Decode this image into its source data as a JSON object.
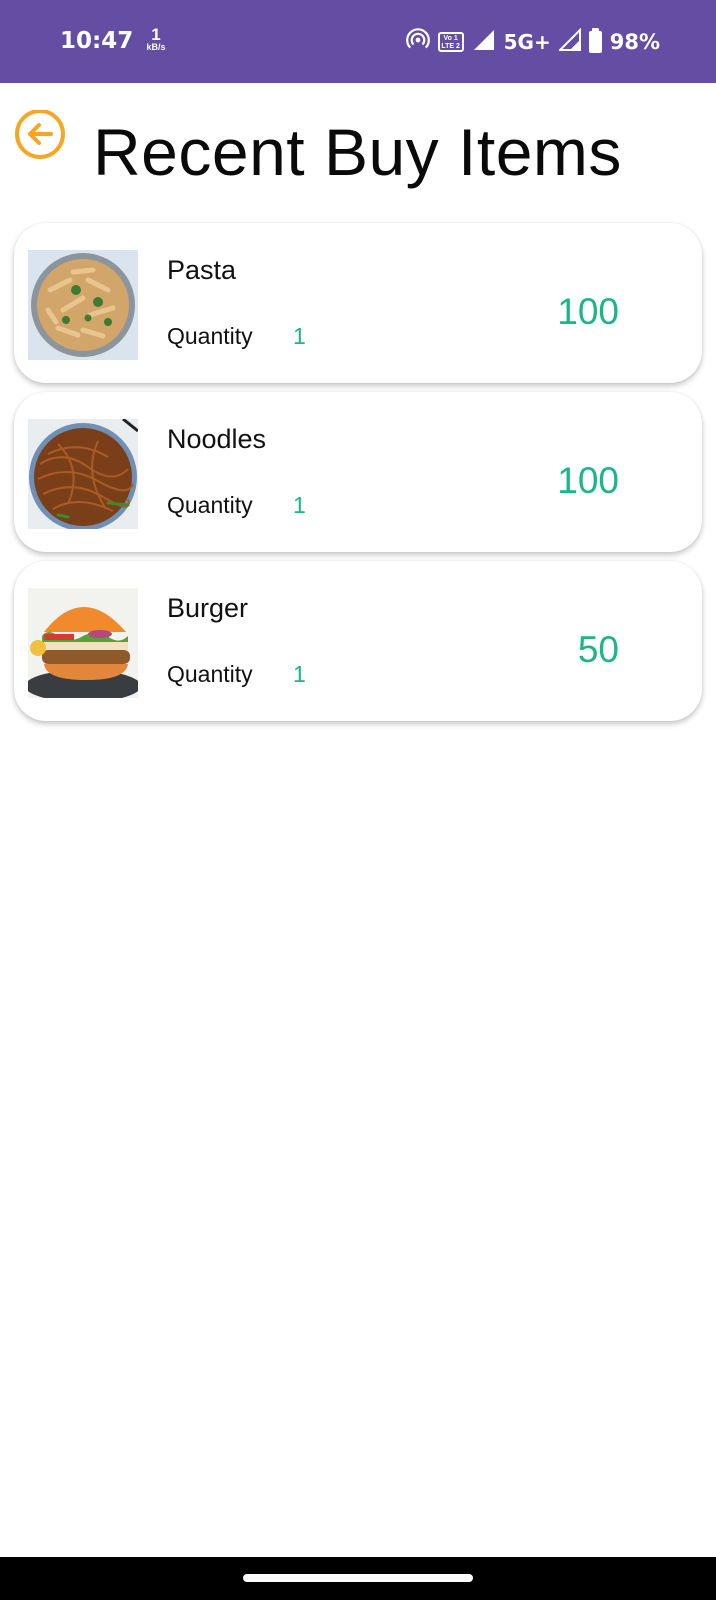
{
  "status_bar": {
    "time": "10:47",
    "speed_value": "1",
    "speed_unit": "kB/s",
    "volte_line1": "Vo 1",
    "volte_line2": "LTE 2",
    "network": "5G+",
    "battery": "98%",
    "icons": [
      "hotspot-icon",
      "volte-icon",
      "signal-icon",
      "signal-icon",
      "battery-icon"
    ]
  },
  "header": {
    "back_icon": "arrow-left-circle-icon",
    "title": "Recent Buy Items"
  },
  "colors": {
    "status_bar": "#644ea3",
    "accent_back": "#f5a623",
    "price_green": "#1bb58a"
  },
  "items": [
    {
      "name": "Pasta",
      "quantity_label": "Quantity",
      "quantity": "1",
      "price": "100",
      "image": "pasta-bowl"
    },
    {
      "name": "Noodles",
      "quantity_label": "Quantity",
      "quantity": "1",
      "price": "100",
      "image": "noodles-plate"
    },
    {
      "name": "Burger",
      "quantity_label": "Quantity",
      "quantity": "1",
      "price": "50",
      "image": "burger-plate"
    }
  ]
}
